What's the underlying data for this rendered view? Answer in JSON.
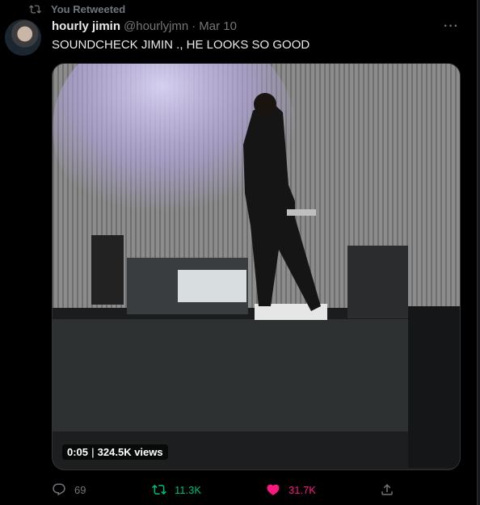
{
  "retweet": {
    "label": "You Retweeted",
    "icon": "retweet-icon"
  },
  "author": {
    "name": "hourly jimin",
    "handle": "@hourlyjmn",
    "separator": "·",
    "date": "Mar 10"
  },
  "tweet": {
    "text": "SOUNDCHECK JIMIN ., HE LOOKS SO GOOD"
  },
  "media": {
    "duration": "0:05",
    "views": "324.5K views"
  },
  "actions": {
    "reply_count": "69",
    "retweet_count": "11.3K",
    "like_count": "31.7K",
    "reply_icon": "reply-icon",
    "retweet_icon": "retweet-icon",
    "like_icon": "heart-icon",
    "share_icon": "share-icon"
  },
  "colors": {
    "background": "#000000",
    "text": "#e7e9ea",
    "muted": "#71767b",
    "retweet_active": "#00ba7c",
    "like_active": "#f91880"
  }
}
